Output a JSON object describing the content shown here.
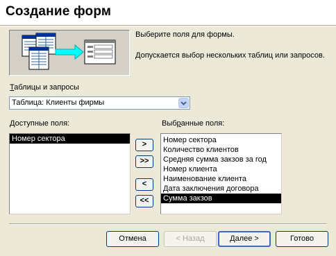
{
  "window": {
    "title": "Создание форм"
  },
  "description": {
    "line1": "Выберите поля для формы.",
    "line2": "Допускается выбор нескольких таблиц или запросов."
  },
  "source": {
    "label_underline": "Т",
    "label_rest": "аблицы и запросы",
    "selected": "Таблица: Клиенты фирмы"
  },
  "available": {
    "label_underline": "Д",
    "label_rest": "оступные поля:",
    "items": [
      "Номер сектора"
    ]
  },
  "selected_fields": {
    "label_rest_before": "Выб",
    "label_underline": "р",
    "label_rest_after": "анные поля:",
    "items": [
      "Номер сектора",
      "Количество клиентов",
      "Средняя сумма закзов за год",
      "Номер клиента",
      "Наименование клиента",
      "Дата заключения договора",
      "Сумма закзов"
    ]
  },
  "move_buttons": {
    "add_one": ">",
    "add_all": ">>",
    "remove_one": "<",
    "remove_all": "<<"
  },
  "footer": {
    "cancel": "Отмена",
    "back": "< Назад",
    "next": "Далее >",
    "finish": "Готово"
  }
}
